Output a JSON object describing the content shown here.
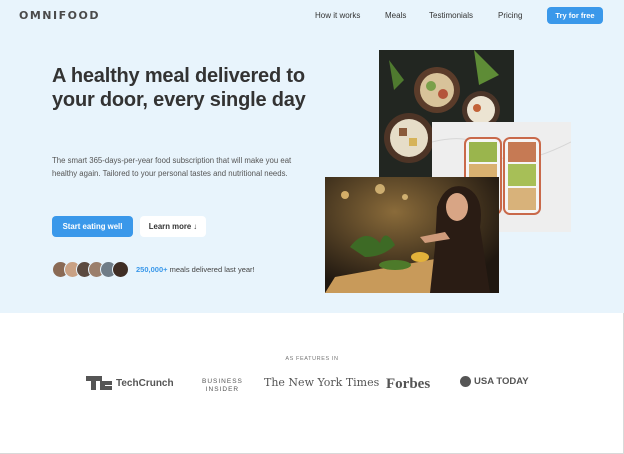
{
  "nav": {
    "logo": "OMNIFOOD",
    "links": [
      "How it works",
      "Meals",
      "Testimonials",
      "Pricing"
    ],
    "cta": "Try for free",
    "accent_color": "#3a98ea"
  },
  "hero": {
    "headline": "A healthy meal delivered to your door, every single day",
    "description": "The smart 365-days-per-year food subscription that will make you eat healthy again. Tailored to your personal tastes and nutritional needs.",
    "primary_button": "Start eating well",
    "secondary_button": "Learn more ↓",
    "delivered_count": "250,000+",
    "delivered_text": " meals delivered last year!",
    "background_color": "#e8f4fc",
    "images": [
      {
        "name": "food-bowls-image",
        "icon": "photo"
      },
      {
        "name": "meal-prep-containers-image",
        "icon": "photo"
      },
      {
        "name": "woman-eating-image",
        "icon": "photo"
      }
    ]
  },
  "featured": {
    "title": "AS FEATURES IN",
    "logos": {
      "techcrunch": "TechCrunch",
      "business_insider_1": "BUSINESS",
      "business_insider_2": "INSIDER",
      "nyt": "The New York Times",
      "forbes": "Forbes",
      "usatoday": "USA TODAY"
    }
  }
}
